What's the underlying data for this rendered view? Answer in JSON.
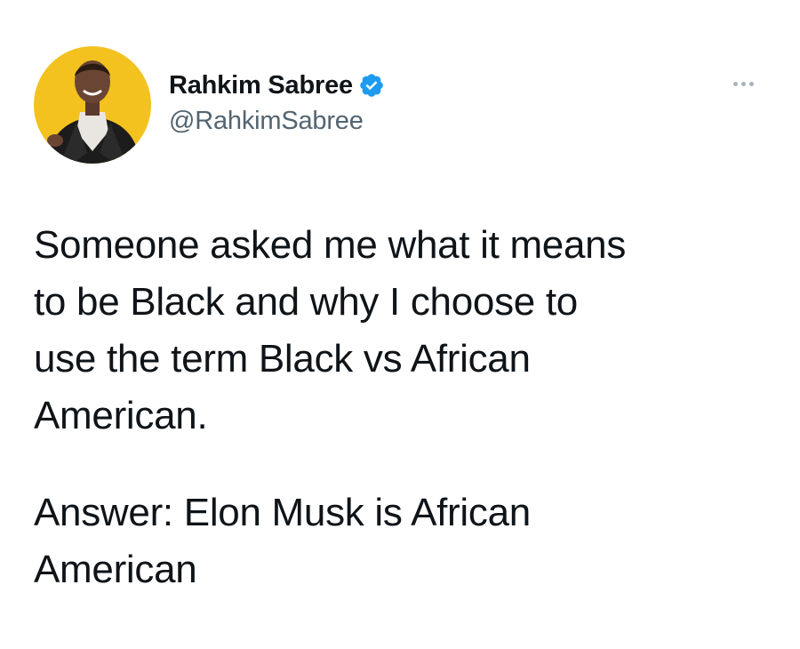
{
  "tweet": {
    "author": {
      "display_name": "Rahkim Sabree",
      "handle": "@RahkimSabree",
      "verified": true,
      "avatar_icon": "avatar-photo",
      "avatar_bg": "#f3c21f"
    },
    "more_icon": "more-options-icon",
    "body": {
      "paragraph_1": [
        "Someone asked me what it means",
        "to be Black and why I choose to",
        "use the term Black vs African",
        "American."
      ],
      "paragraph_2": [
        "Answer: Elon Musk is African",
        "American"
      ]
    },
    "colors": {
      "text": "#0f1419",
      "secondary_text": "#536471",
      "verified_blue": "#1d9bf0"
    }
  }
}
